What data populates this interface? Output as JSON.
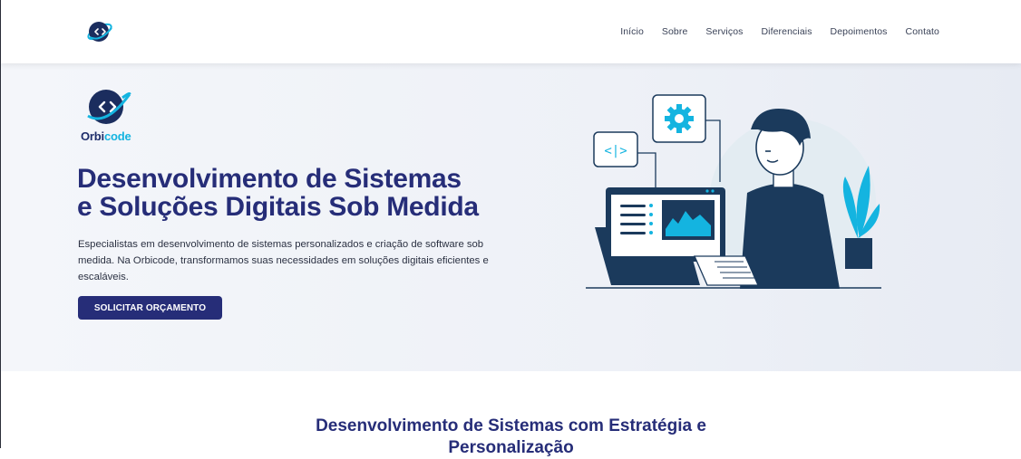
{
  "nav": {
    "logo_icon": "orbit-code-logo-icon",
    "links": [
      "Início",
      "Sobre",
      "Serviços",
      "Diferenciais",
      "Depoimentos",
      "Contato"
    ]
  },
  "hero": {
    "brand_part1": "Orbi",
    "brand_part2": "code",
    "title_line1": "Desenvolvimento de Sistemas",
    "title_line2": "e Soluções Digitais Sob Medida",
    "description": "Especialistas em desenvolvimento de sistemas personalizados e criação de software sob medida. Na Orbicode, transformamos suas necessidades em soluções digitais eficientes e escaláveis.",
    "cta_label": "SOLICITAR ORÇAMENTO",
    "illustration_icon": "developer-at-laptop-illustration"
  },
  "section": {
    "title_line1": "Desenvolvimento de Sistemas com Estratégia e",
    "title_line2": "Personalização"
  },
  "colors": {
    "brand_navy": "#262d78",
    "brand_cyan": "#14b4e0",
    "illustration_navy": "#1b3a5c"
  }
}
